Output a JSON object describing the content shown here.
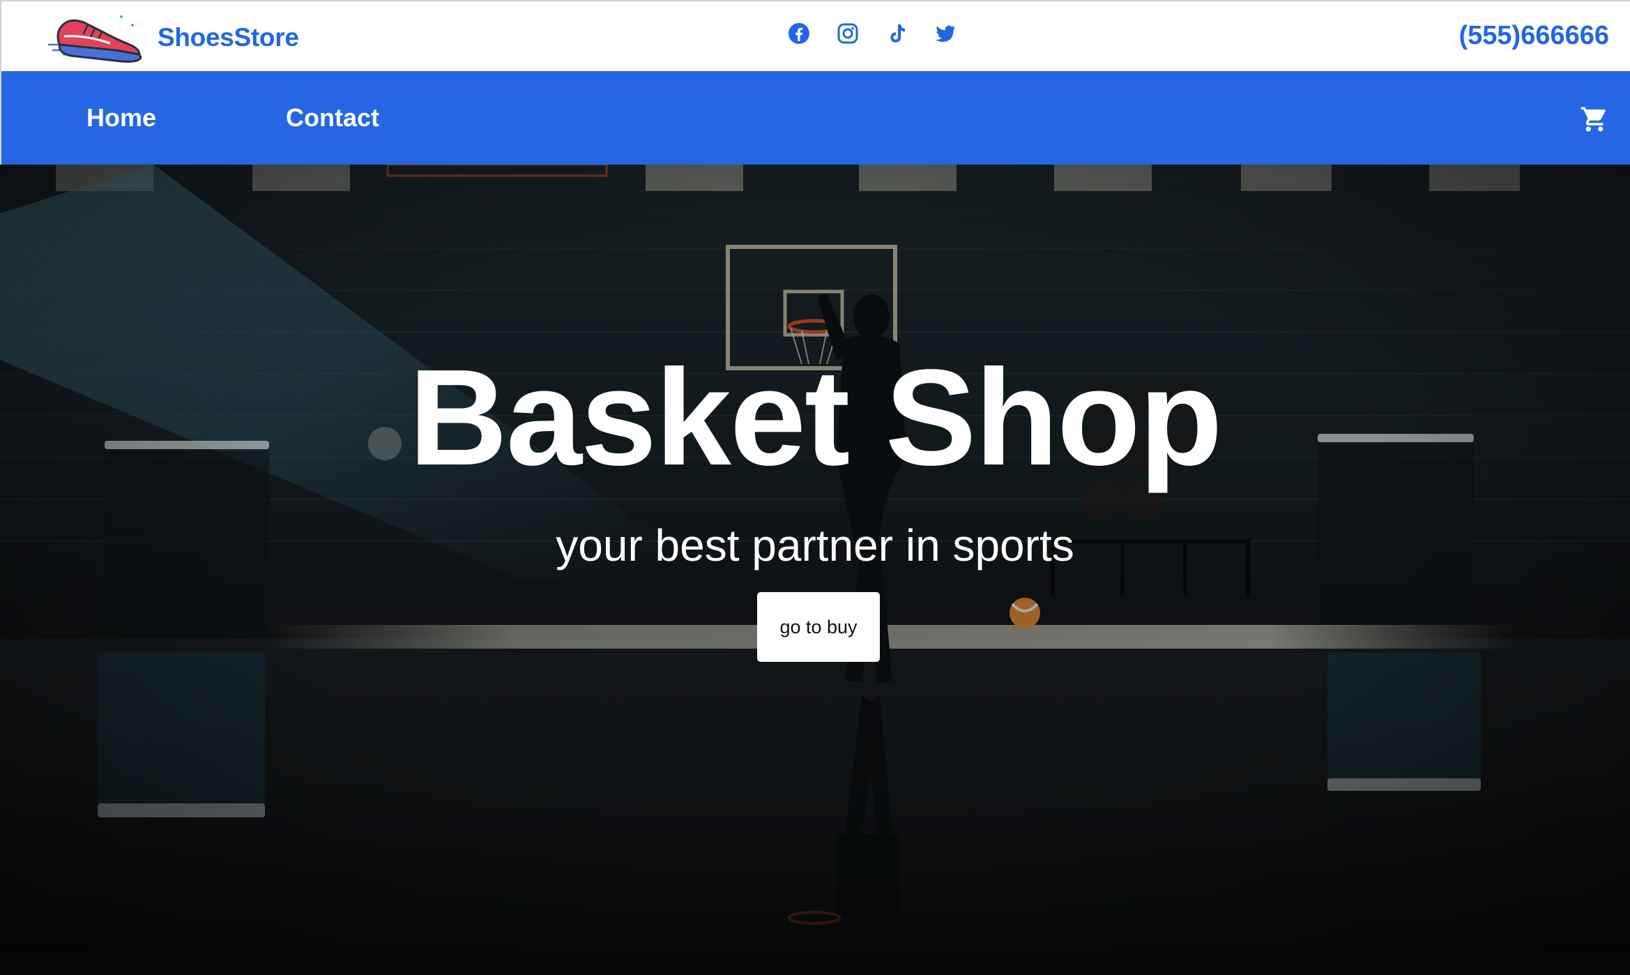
{
  "header": {
    "brand": "ShoesStore",
    "phone": "(555)666666",
    "socials": [
      {
        "icon": "facebook-icon"
      },
      {
        "icon": "instagram-icon"
      },
      {
        "icon": "tiktok-icon"
      },
      {
        "icon": "twitter-icon"
      }
    ]
  },
  "nav": {
    "items": [
      {
        "label": "Home"
      },
      {
        "label": "Contact"
      }
    ],
    "cart_icon": "cart-icon"
  },
  "hero": {
    "title": "Basket Shop",
    "subtitle": "your best partner in sports",
    "cta_label": "go to buy"
  },
  "colors": {
    "brand": "#2266e3",
    "navbar": "#2466e4",
    "white": "#ffffff",
    "shoe_red": "#e2425a",
    "shoe_blue": "#4a6fd8"
  }
}
